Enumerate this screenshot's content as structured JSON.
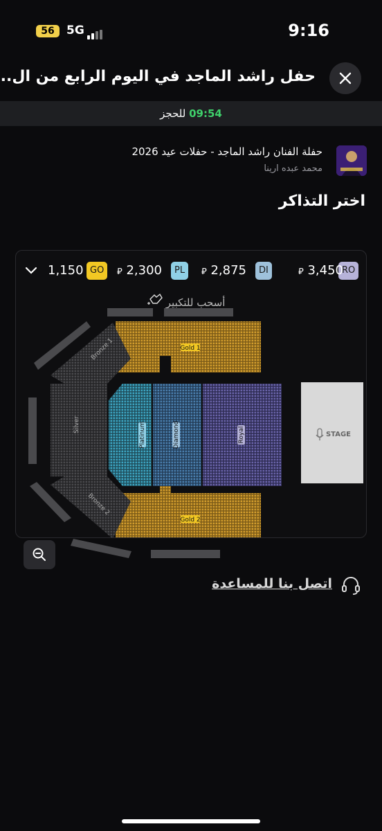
{
  "status_bar": {
    "battery": "56",
    "network": "5G",
    "time": "9:16"
  },
  "header": {
    "title": "حفل راشد الماجد في اليوم الرابع من ال...",
    "close_icon": "close-icon"
  },
  "timer": {
    "time": "09:54",
    "label": "للحجز"
  },
  "event": {
    "title": "حفلة الفنان راشد الماجد - حفلات عيد 2026",
    "venue": "محمد عبده ارينا"
  },
  "section_title": "اختر التذاكر",
  "price_categories": [
    {
      "code": "RO",
      "price": "3,450",
      "currency": "⃁",
      "color": "#b7b3d9"
    },
    {
      "code": "DI",
      "price": "2,875",
      "currency": "⃁",
      "color": "#9ec1db"
    },
    {
      "code": "PL",
      "price": "2,300",
      "currency": "⃁",
      "color": "#8fd0e6"
    },
    {
      "code": "GO",
      "price": "1,150",
      "currency": "",
      "color": "#f2c823"
    }
  ],
  "map": {
    "hint": "أسحب للتكبير",
    "sections": {
      "gold_1": "Gold 1",
      "gold_2": "Gold 2",
      "bronze_1": "Bronze 1",
      "bronze_2": "Bronze 2",
      "silver": "Silver",
      "platinum": "Platinum",
      "diamond": "Diamond",
      "royal": "Royal",
      "stage": "STAGE"
    },
    "colors": {
      "gold": "#c8952b",
      "gold_label": "#f2c823",
      "platinum": "#39a8c8",
      "diamond": "#4c86b3",
      "royal": "#6e68b0",
      "silver": "#3a3a3c",
      "stage": "#d9d9d9"
    }
  },
  "help": {
    "label": "اتصل بنا للمساعدة",
    "icon": "headset-icon"
  }
}
